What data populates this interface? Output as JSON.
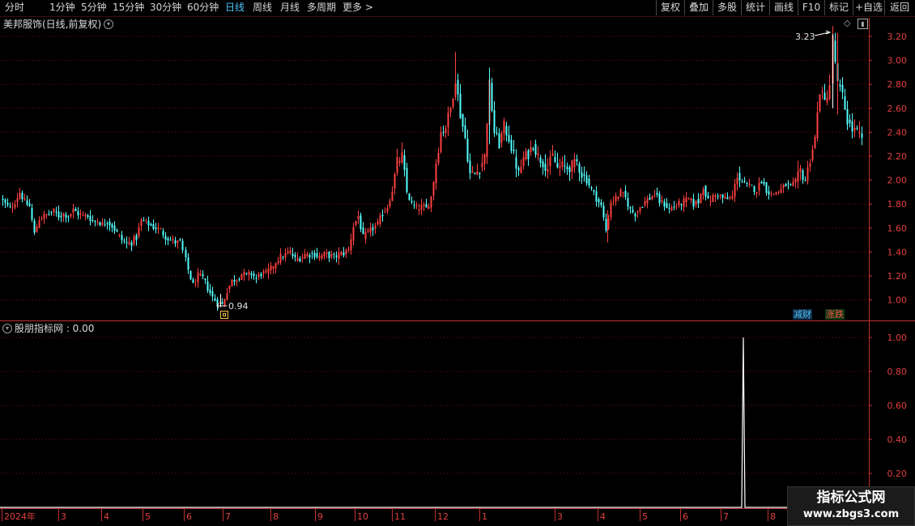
{
  "toolbar": {
    "periods": [
      "分时",
      "1分钟",
      "5分钟",
      "15分钟",
      "30分钟",
      "60分钟",
      "日线",
      "周线",
      "月线",
      "多周期",
      "更多 >"
    ],
    "active_period": "日线",
    "right_buttons": [
      "复权",
      "叠加",
      "多股",
      "统计",
      "画线",
      "F10",
      "标记",
      "+自选",
      "返回"
    ]
  },
  "main_chart": {
    "title": "美邦服饰(日线,前复权)",
    "high_label": "3.23",
    "low_label": "0.94",
    "badge_a": "减财",
    "badge_b": "涨跌",
    "y_ticks": [
      "3.20",
      "3.00",
      "2.80",
      "2.60",
      "2.40",
      "2.20",
      "2.00",
      "1.80",
      "1.60",
      "1.40",
      "1.20",
      "1.00"
    ]
  },
  "indicator": {
    "title": "股朋指标网 : 0.00",
    "y_ticks": [
      "1.00",
      "0.80",
      "0.60",
      "0.40",
      "0.20"
    ]
  },
  "x_axis": {
    "labels": [
      "2024年",
      "3",
      "4",
      "5",
      "6",
      "7",
      "8",
      "9",
      "10",
      "11",
      "12",
      "1",
      "3",
      "4",
      "5",
      "6",
      "7",
      "8"
    ]
  },
  "watermark": {
    "title": "指标公式网",
    "url": "www.zbgs3.com"
  },
  "colors": {
    "up": "#ff4040",
    "down": "#54ffff",
    "grid": "#6b1515",
    "axis": "#c03030",
    "indicator_line": "#ffffff",
    "active_tab": "#4fc3f7"
  },
  "chart_data": {
    "type": "candlestick",
    "title": "美邦服饰(日线,前复权)",
    "x_range": [
      "2024-02",
      "2025-09"
    ],
    "ylim": [
      0.88,
      3.3
    ],
    "close_path": [
      [
        0,
        1.85
      ],
      [
        6,
        1.8
      ],
      [
        12,
        1.76
      ],
      [
        18,
        1.82
      ],
      [
        24,
        1.9
      ],
      [
        30,
        1.82
      ],
      [
        36,
        1.78
      ],
      [
        42,
        1.55
      ],
      [
        48,
        1.68
      ],
      [
        54,
        1.7
      ],
      [
        60,
        1.72
      ],
      [
        66,
        1.74
      ],
      [
        72,
        1.7
      ],
      [
        78,
        1.72
      ],
      [
        84,
        1.7
      ],
      [
        90,
        1.75
      ],
      [
        96,
        1.72
      ],
      [
        102,
        1.7
      ],
      [
        108,
        1.7
      ],
      [
        114,
        1.66
      ],
      [
        120,
        1.66
      ],
      [
        126,
        1.63
      ],
      [
        132,
        1.66
      ],
      [
        138,
        1.62
      ],
      [
        144,
        1.56
      ],
      [
        150,
        1.5
      ],
      [
        156,
        1.47
      ],
      [
        162,
        1.48
      ],
      [
        168,
        1.52
      ],
      [
        174,
        1.66
      ],
      [
        180,
        1.65
      ],
      [
        186,
        1.62
      ],
      [
        192,
        1.6
      ],
      [
        198,
        1.58
      ],
      [
        204,
        1.53
      ],
      [
        210,
        1.5
      ],
      [
        216,
        1.48
      ],
      [
        222,
        1.48
      ],
      [
        232,
        1.25
      ],
      [
        238,
        1.12
      ],
      [
        244,
        1.2
      ],
      [
        250,
        1.18
      ],
      [
        256,
        1.1
      ],
      [
        262,
        1.02
      ],
      [
        268,
        0.98
      ],
      [
        274,
        0.96
      ],
      [
        280,
        1.08
      ],
      [
        286,
        1.16
      ],
      [
        292,
        1.18
      ],
      [
        298,
        1.22
      ],
      [
        304,
        1.2
      ],
      [
        310,
        1.22
      ],
      [
        316,
        1.18
      ],
      [
        322,
        1.22
      ],
      [
        328,
        1.22
      ],
      [
        334,
        1.26
      ],
      [
        340,
        1.32
      ],
      [
        346,
        1.36
      ],
      [
        352,
        1.38
      ],
      [
        358,
        1.4
      ],
      [
        364,
        1.34
      ],
      [
        370,
        1.35
      ],
      [
        376,
        1.38
      ],
      [
        382,
        1.38
      ],
      [
        388,
        1.38
      ],
      [
        394,
        1.36
      ],
      [
        400,
        1.38
      ],
      [
        406,
        1.37
      ],
      [
        412,
        1.36
      ],
      [
        418,
        1.38
      ],
      [
        424,
        1.39
      ],
      [
        430,
        1.42
      ],
      [
        436,
        1.62
      ],
      [
        442,
        1.7
      ],
      [
        448,
        1.52
      ],
      [
        454,
        1.56
      ],
      [
        460,
        1.6
      ],
      [
        466,
        1.63
      ],
      [
        472,
        1.72
      ],
      [
        478,
        1.78
      ],
      [
        484,
        1.92
      ],
      [
        490,
        2.15
      ],
      [
        496,
        2.2
      ],
      [
        502,
        1.9
      ],
      [
        508,
        1.8
      ],
      [
        514,
        1.76
      ],
      [
        520,
        1.78
      ],
      [
        526,
        1.76
      ],
      [
        532,
        1.86
      ],
      [
        538,
        2.15
      ],
      [
        544,
        2.4
      ],
      [
        550,
        2.45
      ],
      [
        556,
        2.6
      ],
      [
        562,
        2.85
      ],
      [
        568,
        2.55
      ],
      [
        574,
        2.35
      ],
      [
        580,
        2.05
      ],
      [
        586,
        2.05
      ],
      [
        592,
        2.1
      ],
      [
        598,
        2.2
      ],
      [
        604,
        2.8
      ],
      [
        610,
        2.4
      ],
      [
        616,
        2.3
      ],
      [
        622,
        2.45
      ],
      [
        628,
        2.35
      ],
      [
        634,
        2.2
      ],
      [
        640,
        2.05
      ],
      [
        646,
        2.18
      ],
      [
        652,
        2.22
      ],
      [
        658,
        2.3
      ],
      [
        664,
        2.2
      ],
      [
        670,
        2.15
      ],
      [
        676,
        2.1
      ],
      [
        682,
        2.2
      ],
      [
        688,
        2.1
      ],
      [
        694,
        2.12
      ],
      [
        700,
        2.1
      ],
      [
        706,
        2.12
      ],
      [
        712,
        2.15
      ],
      [
        718,
        2.05
      ],
      [
        724,
        2.0
      ],
      [
        730,
        1.92
      ],
      [
        736,
        1.85
      ],
      [
        742,
        1.78
      ],
      [
        748,
        1.58
      ],
      [
        754,
        1.82
      ],
      [
        760,
        1.85
      ],
      [
        766,
        1.9
      ],
      [
        772,
        1.85
      ],
      [
        778,
        1.75
      ],
      [
        784,
        1.72
      ],
      [
        790,
        1.78
      ],
      [
        796,
        1.82
      ],
      [
        802,
        1.85
      ],
      [
        808,
        1.88
      ],
      [
        814,
        1.82
      ],
      [
        820,
        1.8
      ],
      [
        826,
        1.76
      ],
      [
        832,
        1.78
      ],
      [
        838,
        1.8
      ],
      [
        844,
        1.82
      ],
      [
        850,
        1.84
      ],
      [
        856,
        1.8
      ],
      [
        862,
        1.82
      ],
      [
        868,
        1.95
      ],
      [
        874,
        1.82
      ],
      [
        880,
        1.86
      ],
      [
        886,
        1.88
      ],
      [
        892,
        1.85
      ],
      [
        898,
        1.84
      ],
      [
        904,
        1.86
      ],
      [
        910,
        2.05
      ],
      [
        916,
        1.98
      ],
      [
        922,
        1.95
      ],
      [
        928,
        1.94
      ],
      [
        934,
        1.92
      ],
      [
        940,
        2.0
      ],
      [
        946,
        1.92
      ],
      [
        952,
        1.88
      ],
      [
        958,
        1.9
      ],
      [
        964,
        1.92
      ],
      [
        970,
        1.96
      ],
      [
        976,
        1.94
      ],
      [
        982,
        1.98
      ],
      [
        988,
        2.08
      ],
      [
        994,
        2.0
      ],
      [
        1000,
        2.18
      ],
      [
        1006,
        2.35
      ],
      [
        1012,
        2.75
      ],
      [
        1018,
        2.65
      ],
      [
        1024,
        2.8
      ],
      [
        1028,
        3.18
      ],
      [
        1034,
        2.8
      ],
      [
        1040,
        2.7
      ],
      [
        1046,
        2.5
      ],
      [
        1052,
        2.42
      ],
      [
        1058,
        2.4
      ],
      [
        1064,
        2.33
      ]
    ],
    "indicator_series": {
      "name": "股朋指标网",
      "baseline": 0.0,
      "spike_value": 1.0,
      "spike_at": "2025-07"
    }
  }
}
